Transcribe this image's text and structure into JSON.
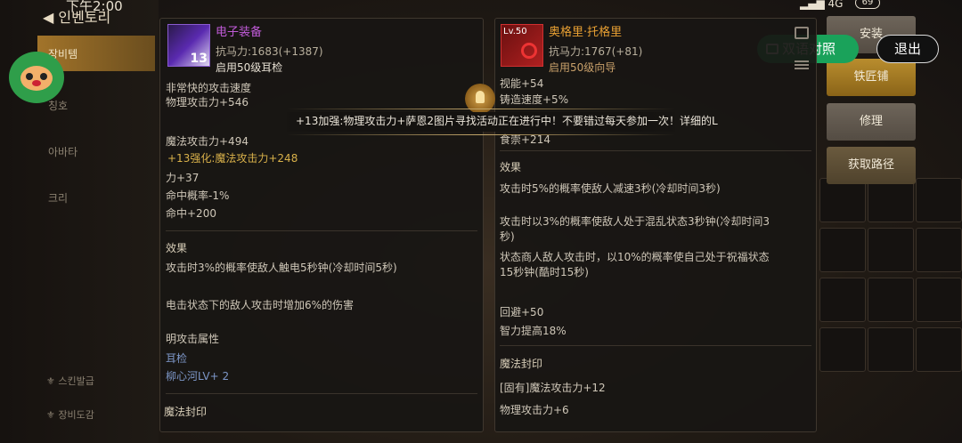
{
  "status": {
    "time": "下午2:00",
    "network": "4G",
    "battery": "69"
  },
  "leftnav": {
    "back_label": "인벤토리",
    "tabs": [
      "장비템",
      "칭호",
      "아바타",
      "크리"
    ],
    "bottom": [
      "스킨발급",
      "장비도감"
    ]
  },
  "overlay": {
    "bilingual": "双语对照",
    "exit": "退出",
    "banner": "+13加强:物理攻击力+萨恩2图片寻找活动正在进行中！不要错过每天参加一次！详细的L"
  },
  "right_buttons": [
    "安装",
    "铁匠铺",
    "修理",
    "获取路径"
  ],
  "item_left": {
    "name": "电子装备",
    "level_badge": "13",
    "resist": "抗马力:1683(+1387)",
    "requirement": "启用50级耳检",
    "attributes": [
      "非常快的攻击速度",
      "物理攻击力+546",
      "魔法攻击力+494",
      "+13强化:魔法攻击力+248",
      "力+37",
      "命中概率-1%",
      "命中+200"
    ],
    "effect_title": "效果",
    "effects": [
      "攻击时3%的概率使敌人触电5秒钟(冷却时间5秒)",
      "电击状态下的敌人攻击时增加6%的伤害"
    ],
    "element_label": "明攻击属性",
    "tags": [
      "耳检",
      "柳心河LV+ 2"
    ],
    "seal_title": "魔法封印"
  },
  "item_right": {
    "name": "奥格里·托格里",
    "level": "Lv.50",
    "resist": "抗马力:1767(+81)",
    "requirement": "启用50级向导",
    "attributes": [
      "视能+54",
      "铸造速度+5%",
      "食崇+214"
    ],
    "effect_title": "效果",
    "effects": [
      "攻击时5%的概率使敌人减速3秒(冷却时间3秒)",
      "攻击时以3%的概率使敌人处于混乱状态3秒钟(冷却时间3秒)",
      "状态商人敌人攻击时，以10%的概率使自己处于祝福状态15秒钟(酷时15秒)"
    ],
    "extras": [
      "回避+50",
      "智力提高18%"
    ],
    "seal_title": "魔法封印",
    "seal_items": [
      "[固有]魔法攻击力+12",
      "物理攻击力+6"
    ]
  }
}
